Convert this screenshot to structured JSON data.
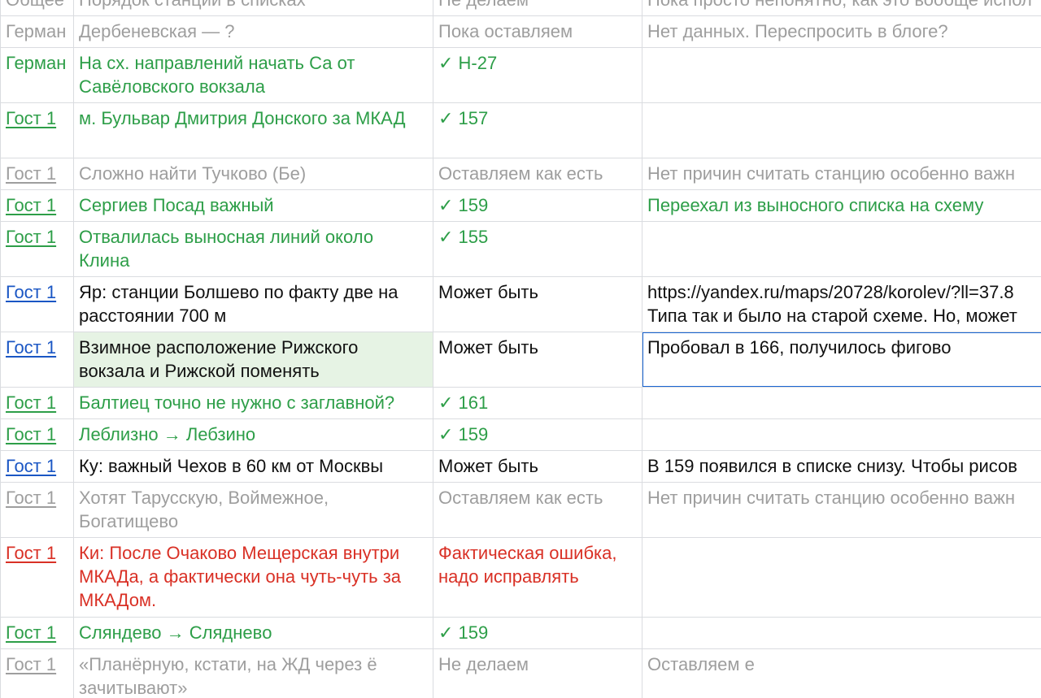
{
  "rows": [
    {
      "tone": "gray",
      "first": "Общее",
      "link": false,
      "problem": "Порядок станций в списках",
      "status": "Не делаем",
      "comment": "Пока просто непонятно, как это вообще испол",
      "height": 38
    },
    {
      "tone": "gray",
      "first": "Герман",
      "link": false,
      "problem": "Дербеневская — ?",
      "status": "Пока оставляем",
      "comment": "Нет данных. Переспросить в блоге?",
      "height": 38
    },
    {
      "tone": "green",
      "first": "Герман",
      "link": false,
      "problem": "На сх. направлений начать Са от Савёловского вокзала",
      "status": "✓ Н-27",
      "comment": "",
      "height": 68
    },
    {
      "tone": "green",
      "first": "Гост 1",
      "link": true,
      "problem": "м. Бульвар Дмитрия Донского за МКАД",
      "status": "✓ 157",
      "comment": "",
      "height": 68
    },
    {
      "tone": "gray",
      "first": "Гост 1",
      "link": true,
      "problem": "Сложно найти Тучково (Бе)",
      "status": "Оставляем как есть",
      "comment": "Нет причин считать станцию особенно важн",
      "height": 38
    },
    {
      "tone": "green",
      "first": "Гост 1",
      "link": true,
      "problem": "Сергиев Посад важный",
      "status": "✓ 159",
      "comment": "Переехал из выносного списка на схему",
      "height": 38
    },
    {
      "tone": "green",
      "first": "Гост 1",
      "link": true,
      "problem": "Отвалилась выносная линий около Клина",
      "status": "✓ 155",
      "comment": "",
      "height": 68
    },
    {
      "tone": "black",
      "first": "Гост 1",
      "link": true,
      "problem": "Яр: станции Болшево по факту две на расстоянии 700 м",
      "status": "Может быть",
      "comment": "https://yandex.ru/maps/20728/korolev/?ll=37.8\nТипа так и было на старой схеме. Но, может",
      "height": 68
    },
    {
      "tone": "black",
      "first": "Гост 1",
      "link": true,
      "problem": "Взимное расположение Рижского вокзала и Рижской поменять",
      "status": "Может быть",
      "comment": "Пробовал в 166, получилось фигово",
      "height": 68,
      "highlight": true,
      "selected": true
    },
    {
      "tone": "green",
      "first": "Гост 1",
      "link": true,
      "problem": "Балтиец точно не нужно с заглавной?",
      "status": "✓ 161",
      "comment": "",
      "height": 38
    },
    {
      "tone": "green",
      "first": "Гост 1",
      "link": true,
      "problem": "Леблизно → Лебзино",
      "status": "✓ 159",
      "comment": "",
      "height": 38
    },
    {
      "tone": "black",
      "first": "Гост 1",
      "link": true,
      "problem": "Ку: важный Чехов в 60 км от Москвы",
      "status": "Может быть",
      "comment": "В 159 появился в списке снизу. Чтобы рисов",
      "height": 38
    },
    {
      "tone": "gray",
      "first": "Гост 1",
      "link": true,
      "problem": "Хотят Тарусскую, Воймежное, Богатищево",
      "status": "Оставляем как есть",
      "comment": "Нет причин считать станцию особенно важн",
      "height": 68
    },
    {
      "tone": "red",
      "first": "Гост 1",
      "link": true,
      "problem": "Ки: После Очаково Мещерская внутри МКАДа, а фактически она чуть-чуть за МКАДом.",
      "status": "Фактическая ошибка, надо исправлять",
      "comment": "",
      "height": 98
    },
    {
      "tone": "green",
      "first": "Гост 1",
      "link": true,
      "problem": "Сляндево → Слядневo",
      "status": "✓ 159",
      "comment": "",
      "height": 38
    },
    {
      "tone": "gray",
      "first": "Гост 1",
      "link": true,
      "problem": "«Планёрную, кстати, на ЖД через ё зачитывают»",
      "status": "Не делаем",
      "comment": "Оставляем е",
      "height": 68
    }
  ]
}
